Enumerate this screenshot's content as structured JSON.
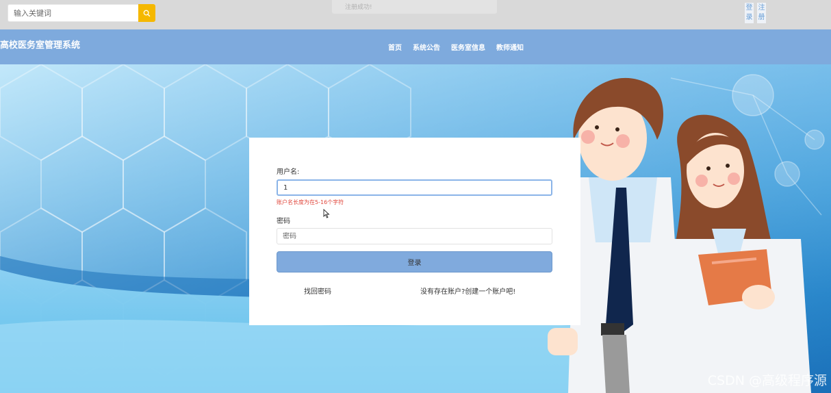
{
  "topbar": {
    "search_placeholder": "输入关键词",
    "toast": "注册成功!",
    "login": "登录",
    "register": "注册"
  },
  "navbar": {
    "site_title": "高校医务室管理系统",
    "items": [
      "首页",
      "系统公告",
      "医务室信息",
      "教师通知"
    ]
  },
  "login_form": {
    "username_label": "用户名:",
    "username_value": "1",
    "username_error": "账户名长度为在5-16个字符",
    "password_label": "密码",
    "password_placeholder": "密码",
    "submit_label": "登录",
    "forgot_link": "找回密码",
    "register_link": "没有存在账户?创建一个账户吧!"
  },
  "watermark": "CSDN @高级程序源",
  "colors": {
    "navbar": "#7eaadd",
    "search_button": "#f5b800",
    "error": "#e0453a",
    "login_button": "#80aadd"
  }
}
